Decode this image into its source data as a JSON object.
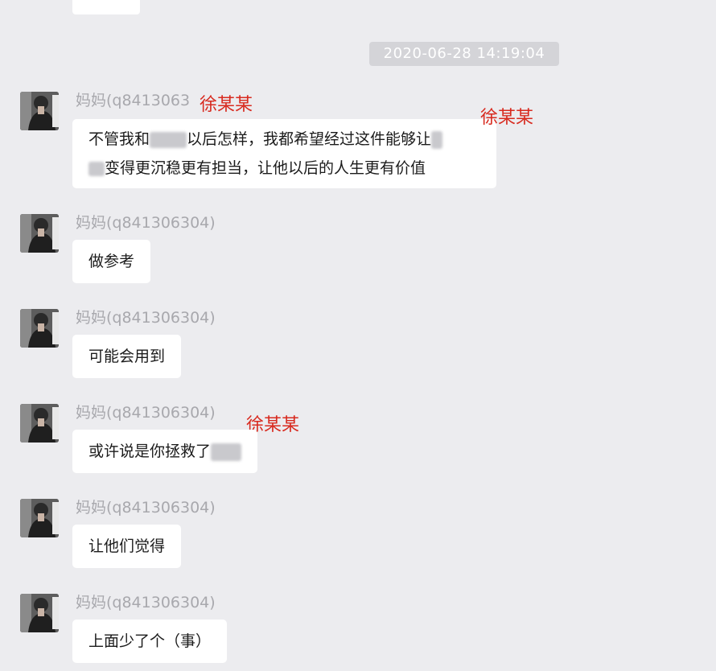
{
  "timestamp": "2020-06-28 14:19:04",
  "sender_name": "妈妈(q841306304)",
  "sender_name_truncated": "妈妈(q8413063",
  "annotation_color": "#d82a1f",
  "messages": [
    {
      "lines": [
        {
          "before": "不管我和",
          "after": "以后怎样，我都希望经过这件能够让"
        },
        {
          "before": "",
          "after": "变得更沉稳更有担当，让他以后的人生更有价值"
        }
      ],
      "annotations": [
        "徐某某",
        "徐某某"
      ]
    },
    {
      "text": "做参考"
    },
    {
      "text": "可能会用到"
    },
    {
      "text": "或许说是你拯救了",
      "annotations": [
        "徐某某"
      ]
    },
    {
      "text": "让他们觉得"
    },
    {
      "text": "上面少了个（事）"
    }
  ],
  "avatar_icon": "person-photo-avatar"
}
